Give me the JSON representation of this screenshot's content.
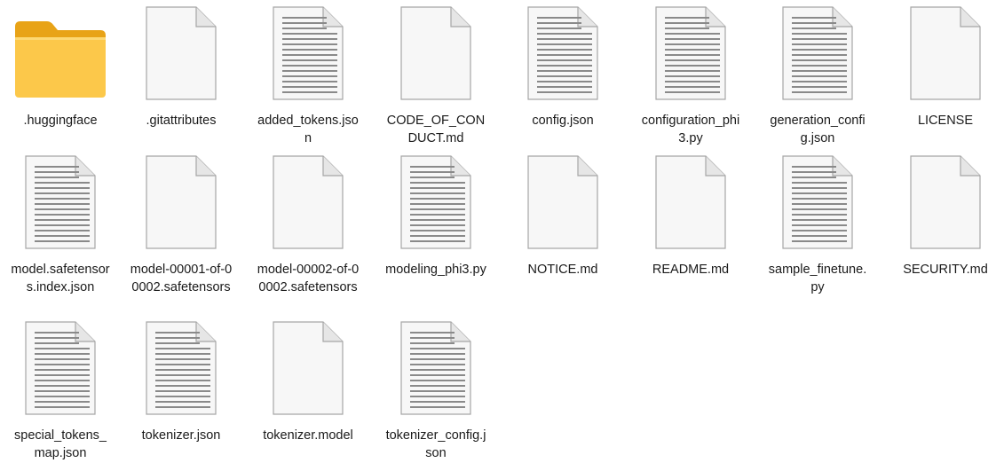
{
  "files": [
    {
      "name": ".huggingface",
      "icon": "folder-icon"
    },
    {
      "name": ".gitattributes",
      "icon": "blank-file-icon"
    },
    {
      "name": "added_tokens.json",
      "icon": "text-file-icon"
    },
    {
      "name": "CODE_OF_CONDUCT.md",
      "icon": "blank-file-icon"
    },
    {
      "name": "config.json",
      "icon": "text-file-icon"
    },
    {
      "name": "configuration_phi3.py",
      "icon": "text-file-icon"
    },
    {
      "name": "generation_config.json",
      "icon": "text-file-icon"
    },
    {
      "name": "LICENSE",
      "icon": "blank-file-icon"
    },
    {
      "name": "model.safetensors.index.json",
      "icon": "text-file-icon"
    },
    {
      "name": "model-00001-of-00002.safetensors",
      "icon": "blank-file-icon"
    },
    {
      "name": "model-00002-of-00002.safetensors",
      "icon": "blank-file-icon"
    },
    {
      "name": "modeling_phi3.py",
      "icon": "text-file-icon"
    },
    {
      "name": "NOTICE.md",
      "icon": "blank-file-icon"
    },
    {
      "name": "README.md",
      "icon": "blank-file-icon"
    },
    {
      "name": "sample_finetune.py",
      "icon": "text-file-icon"
    },
    {
      "name": "SECURITY.md",
      "icon": "blank-file-icon"
    },
    {
      "name": "special_tokens_map.json",
      "icon": "text-file-icon"
    },
    {
      "name": "tokenizer.json",
      "icon": "text-file-icon"
    },
    {
      "name": "tokenizer.model",
      "icon": "blank-file-icon"
    },
    {
      "name": "tokenizer_config.json",
      "icon": "text-file-icon"
    }
  ],
  "colors": {
    "folder_back": "#e8a317",
    "folder_front": "#fcc84a",
    "file_fill": "#f7f7f7",
    "file_stroke": "#a6a6a6",
    "text_lines": "#8a8a8a"
  }
}
